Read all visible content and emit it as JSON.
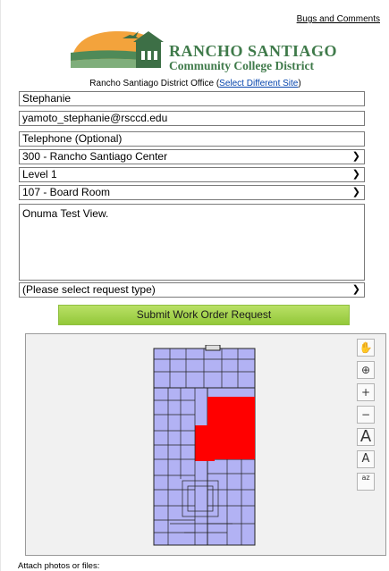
{
  "header": {
    "bugs_link": "Bugs and Comments",
    "logo_line1": "RANCHO SANTIAGO",
    "logo_line2": "Community College District"
  },
  "site": {
    "name": "Rancho Santiago District Office",
    "open_paren": " (",
    "select_link": "Select Different Site",
    "close_paren": ")"
  },
  "form": {
    "name": "Stephanie",
    "email": "yamoto_stephanie@rsccd.edu",
    "telephone_placeholder": "Telephone (Optional)",
    "building": "300 - Rancho Santiago Center",
    "floor": "Level 1",
    "room": "107 - Board Room",
    "description": "Onuma Test View.",
    "request_type": "(Please select request type)",
    "submit_label": "Submit Work Order Request",
    "attach_label": "Attach photos or files:"
  },
  "map_tools": [
    {
      "name": "pan-hand-icon",
      "glyph": "✋"
    },
    {
      "name": "zoom-extents-icon",
      "glyph": "⊕"
    },
    {
      "name": "zoom-in-icon",
      "glyph": "+"
    },
    {
      "name": "zoom-out-icon",
      "glyph": "−"
    },
    {
      "name": "text-larger-icon",
      "glyph": "A"
    },
    {
      "name": "text-smaller-icon",
      "glyph": "A"
    },
    {
      "name": "sort-az-icon",
      "glyph": "az"
    }
  ],
  "colors": {
    "submit_green": "#a6d24f",
    "room_fill": "#b2b2f4",
    "selected_room": "#ff0000",
    "logo_green": "#3f7a4a"
  }
}
